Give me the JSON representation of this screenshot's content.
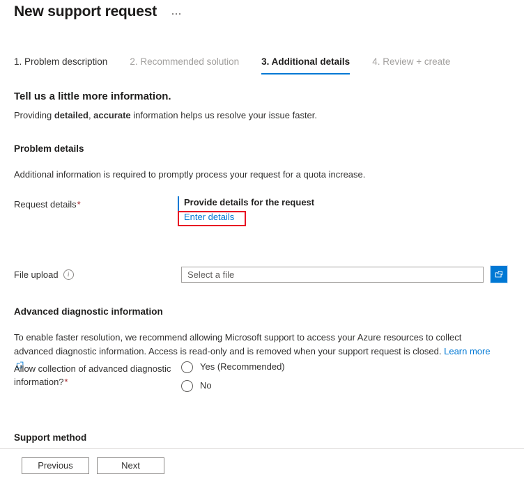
{
  "header": {
    "title": "New support request",
    "more_menu_label": "..."
  },
  "tabs": [
    {
      "label": "1. Problem description",
      "state": "done"
    },
    {
      "label": "2. Recommended solution",
      "state": "disabled"
    },
    {
      "label": "3. Additional details",
      "state": "active"
    },
    {
      "label": "4. Review + create",
      "state": "disabled"
    }
  ],
  "intro": {
    "heading": "Tell us a little more information.",
    "sub_prefix": "Providing ",
    "sub_bold_1": "detailed",
    "sub_mid": ", ",
    "sub_bold_2": "accurate",
    "sub_suffix": " information helps us resolve your issue faster."
  },
  "problem_details": {
    "heading": "Problem details",
    "description": "Additional information is required to promptly process your request for a quota increase.",
    "request_details_label": "Request details",
    "required_marker": "*",
    "provide_details_title": "Provide details for the request",
    "enter_details_link": "Enter details"
  },
  "file_upload": {
    "label": "File upload",
    "info_icon": "info-icon",
    "info_glyph": "i",
    "placeholder": "Select a file",
    "value": "",
    "browse_icon": "folder-open-icon"
  },
  "advanced_diagnostics": {
    "heading": "Advanced diagnostic information",
    "paragraph": "To enable faster resolution, we recommend allowing Microsoft support to access your Azure resources to collect advanced diagnostic information. Access is read-only and is removed when your support request is closed. ",
    "learn_more_label": "Learn more",
    "external_icon": "external-link-icon",
    "question_label": "Allow collection of advanced diagnostic information?",
    "required_marker": "*",
    "options": [
      {
        "label": "Yes (Recommended)",
        "checked": false
      },
      {
        "label": "No",
        "checked": false
      }
    ]
  },
  "support_method": {
    "heading": "Support method"
  },
  "footer": {
    "previous_label": "Previous",
    "next_label": "Next"
  },
  "colors": {
    "accent": "#0078d4",
    "highlight_box": "#e81123",
    "required_star": "#a4262c",
    "disabled_text": "#a19f9d"
  }
}
